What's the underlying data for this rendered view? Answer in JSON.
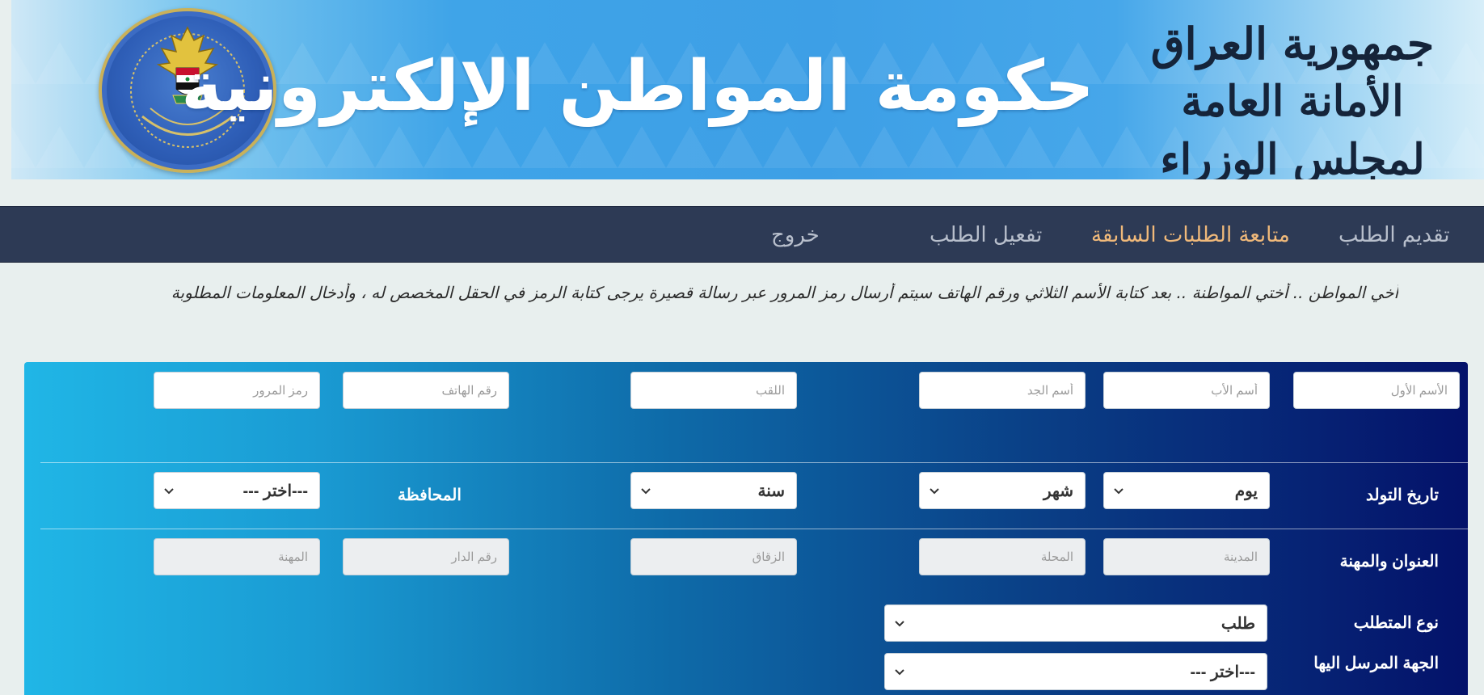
{
  "banner": {
    "title": "حكومة المواطن الإلكترونية",
    "calligraphy_line1": "جمهورية العراق",
    "calligraphy_line2": "الأمانة العامة لمجلس الوزراء",
    "seal_label": "الأمانة العامة لمجلس الوزراء"
  },
  "nav": {
    "items": [
      {
        "label": "تقديم الطلب"
      },
      {
        "label": "متابعة الطلبات السابقة"
      },
      {
        "label": "تفعيل الطلب"
      },
      {
        "label": "خروج"
      }
    ],
    "active_color": "#f0b97a"
  },
  "notice": "أخي المواطن .. أختي المواطنة .. بعد كتابة الأسم الثلاثي ورقم الهاتف سيتم أرسال رمز المرور عبر رسالة قصيرة يرجى كتابة الرمز في الحقل المخصص له ، وأدخال المعلومات المطلوبة",
  "form": {
    "name_row": {
      "first_name": "الأسم الأول",
      "father_name": "أسم الأب",
      "grandfather_name": "أسم الجد",
      "surname": "اللقب",
      "phone": "رقم الهاتف",
      "passcode": "رمز المرور"
    },
    "birth_row": {
      "label": "تاريخ التولد",
      "day": "يوم",
      "month": "شهر",
      "year": "سنة",
      "province_label": "المحافظة",
      "province": "---اختر ---"
    },
    "address_row": {
      "label": "العنوان والمهنة",
      "city": "المدينة",
      "district": "المحلة",
      "alley": "الزقاق",
      "house_number": "رقم الدار",
      "profession": "المهنة"
    },
    "request_type": {
      "label": "نوع المتطلب",
      "value": "طلب"
    },
    "recipient": {
      "label": "الجهة المرسل اليها",
      "value": "---اختر ---"
    }
  }
}
